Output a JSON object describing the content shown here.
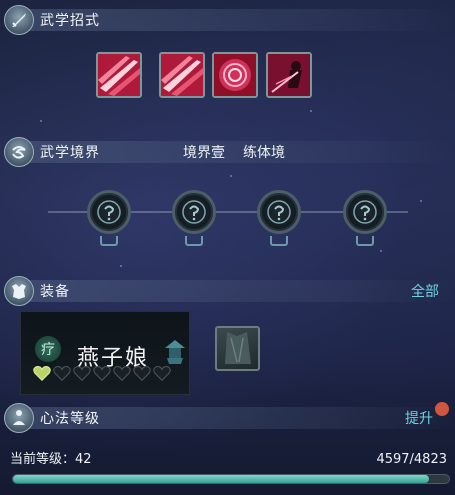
{
  "sections": {
    "skills": {
      "title": "武学招式"
    },
    "realm": {
      "title": "武学境界",
      "realm_value": "境界壹",
      "realm_stage": "练体境"
    },
    "equipment": {
      "title": "装备",
      "all_link": "全部",
      "item": {
        "badge": "疗",
        "name": "燕子娘",
        "hearts_filled": 1,
        "hearts_total": 7
      }
    },
    "mind_method": {
      "title": "心法等级",
      "upgrade_link": "提升",
      "level_label": "当前等级：42",
      "exp_text": "4597/4823",
      "exp_progress": 0.953
    }
  },
  "icons": {
    "skill_slots": [
      "slash-skill-icon",
      "slash-skill-icon",
      "rose-swirl-skill-icon",
      "warrior-strike-skill-icon"
    ],
    "realm_nodes": [
      "locked-node-icon",
      "locked-node-icon",
      "locked-node-icon",
      "locked-node-icon"
    ]
  },
  "colors": {
    "link": "#6fd3e0",
    "exp_fill": "#4fb8ab",
    "notify_dot": "#d2553f",
    "heart_filled": "#b8d36a"
  }
}
